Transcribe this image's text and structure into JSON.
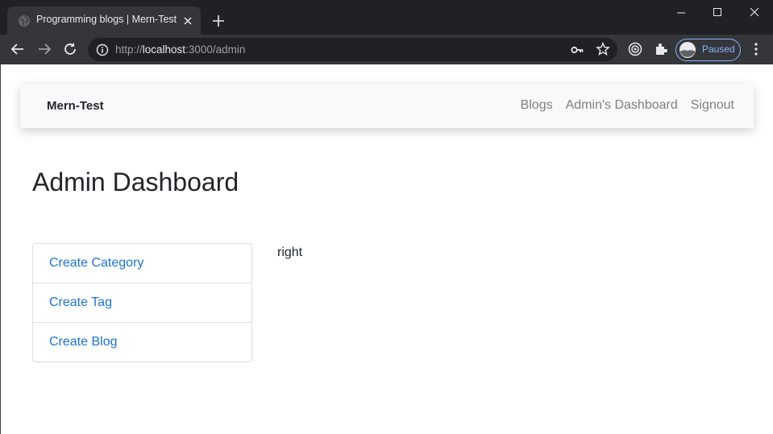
{
  "browser": {
    "tab_title": "Programming blogs | Mern-Test",
    "url_scheme": "http://",
    "url_host": "localhost",
    "url_rest": ":3000/admin",
    "profile_label": "Paused",
    "icons": [
      "globe-icon",
      "close-icon",
      "plus-icon",
      "minimize-icon",
      "maximize-icon",
      "window-close-icon",
      "back-arrow-icon",
      "forward-arrow-icon",
      "reload-icon",
      "info-icon",
      "key-icon",
      "star-icon",
      "media-icon",
      "extensions-icon",
      "avatar",
      "kebab-menu-icon"
    ],
    "colors": {
      "titlebar": "#202124",
      "toolbar": "#35363a",
      "accent": "#8ab4f8"
    }
  },
  "navbar": {
    "brand": "Mern-Test",
    "links": [
      "Blogs",
      "Admin's Dashboard",
      "Signout"
    ]
  },
  "main": {
    "title": "Admin Dashboard",
    "menu": [
      "Create Category",
      "Create Tag",
      "Create Blog"
    ],
    "right_text": "right"
  },
  "theme": {
    "link": "#1a73d9",
    "navbar_bg": "#f8f9fa",
    "text": "#212529"
  }
}
